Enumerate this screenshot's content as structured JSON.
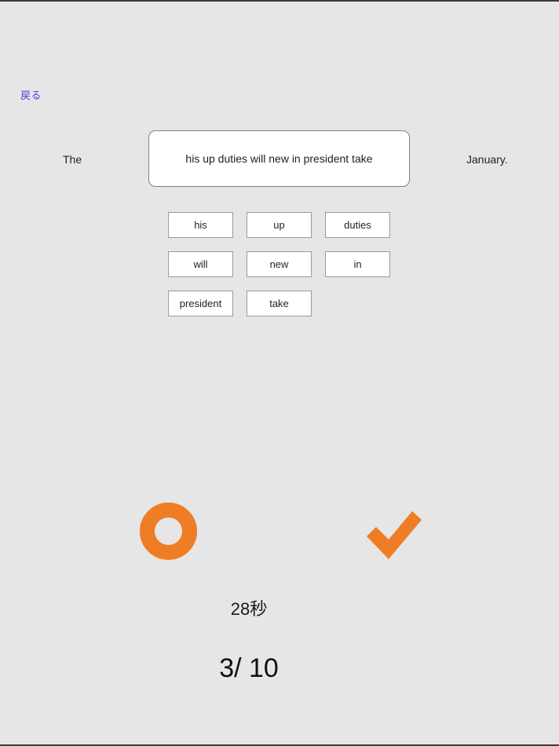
{
  "theme": {
    "background": "#e6e6e6",
    "accent_orange": "#ef7d26",
    "link_color": "#4b3fe4",
    "tile_background": "#ffffff",
    "tile_border": "#9a9a9a",
    "answer_border": "#808080",
    "text_color": "#1a1a1a"
  },
  "nav": {
    "back_label": "戻る"
  },
  "question": {
    "prefix": "The",
    "suffix": "January.",
    "answer_text": "his up duties will new in president take",
    "word_tiles": [
      {
        "label": "his"
      },
      {
        "label": "up"
      },
      {
        "label": "duties"
      },
      {
        "label": "will"
      },
      {
        "label": "new"
      },
      {
        "label": "in"
      },
      {
        "label": "president"
      },
      {
        "label": "take"
      }
    ]
  },
  "result": {
    "maru_icon": "circle-ring-icon",
    "check_icon": "checkmark-icon"
  },
  "status": {
    "timer": "28秒",
    "score": "3/ 10"
  }
}
